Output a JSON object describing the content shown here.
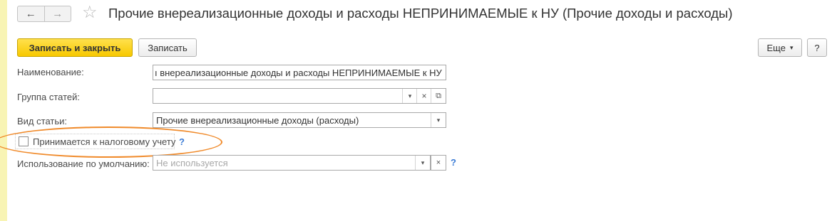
{
  "window": {
    "title": "Прочие внереализационные доходы и расходы НЕПРИНИМАЕМЫЕ к НУ (Прочие доходы и расходы)",
    "back_icon": "←",
    "forward_icon": "→",
    "favorite_icon": "☆"
  },
  "toolbar": {
    "save_close_label": "Записать и закрыть",
    "save_label": "Записать",
    "more_label": "Еще",
    "more_arrow": "▾",
    "help_label": "?"
  },
  "form": {
    "name": {
      "label": "Наименование:",
      "value": "ı внереализационные доходы и расходы НЕПРИНИМАЕМЫЕ к НУ"
    },
    "group": {
      "label": "Группа статей:",
      "value": "",
      "dropdown_glyph": "▾",
      "clear_glyph": "×",
      "open_glyph": "⧉"
    },
    "item_type": {
      "label": "Вид статьи:",
      "value": "Прочие внереализационные доходы (расходы)",
      "dropdown_glyph": "▾"
    },
    "tax_accepted": {
      "label": "Принимается к налоговому учету",
      "checked": false,
      "help": "?"
    },
    "default_usage": {
      "label": "Использование по умолчанию:",
      "placeholder": "Не используется",
      "dropdown_glyph": "▾",
      "clear_glyph": "×",
      "help": "?"
    }
  },
  "colors": {
    "primary_button": "#f7c800",
    "highlight_ellipse": "#f08a2a",
    "left_stripe": "#f8f4b4",
    "help_link": "#3a7bd5"
  }
}
